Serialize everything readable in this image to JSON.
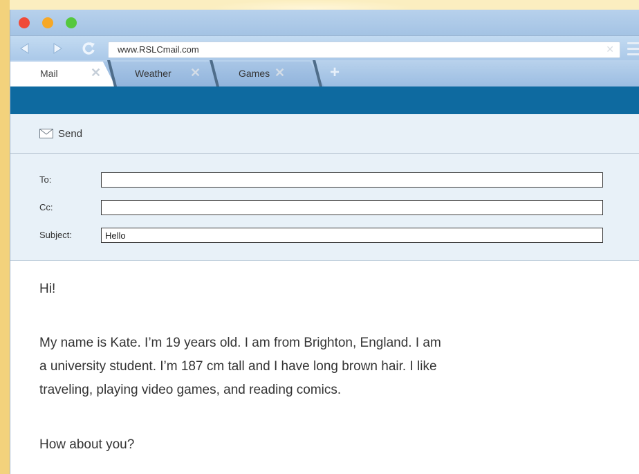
{
  "browser": {
    "url": "www.RSLCmail.com",
    "clear_glyph": "✕",
    "tabs": [
      {
        "label": "Mail",
        "active": true
      },
      {
        "label": "Weather",
        "active": false
      },
      {
        "label": "Games",
        "active": false
      }
    ],
    "new_tab_glyph": "+",
    "colors": {
      "titlebar": "#a4c3e4",
      "accent_bar": "#0e6aa0",
      "compose_bg": "#e8f1f8"
    }
  },
  "compose": {
    "send_label": "Send",
    "to_label": "To:",
    "to_value": "",
    "cc_label": "Cc:",
    "cc_value": "",
    "subject_label": "Subject:",
    "subject_value": "Hello"
  },
  "message": {
    "greeting": "Hi!",
    "lines": [
      "My name is Kate. I’m 19 years old. I am from Brighton, England. I am",
      "a university student. I’m 187 cm tall and I have long brown hair. I like",
      "traveling, playing video games, and reading comics."
    ],
    "closing": "How about you?"
  },
  "icons": {
    "window_controls": [
      "close-dot",
      "minimize-dot",
      "maximize-dot"
    ],
    "nav": [
      "back-arrow-icon",
      "forward-arrow-icon",
      "refresh-icon",
      "menu-icon"
    ],
    "send": "envelope-icon"
  }
}
